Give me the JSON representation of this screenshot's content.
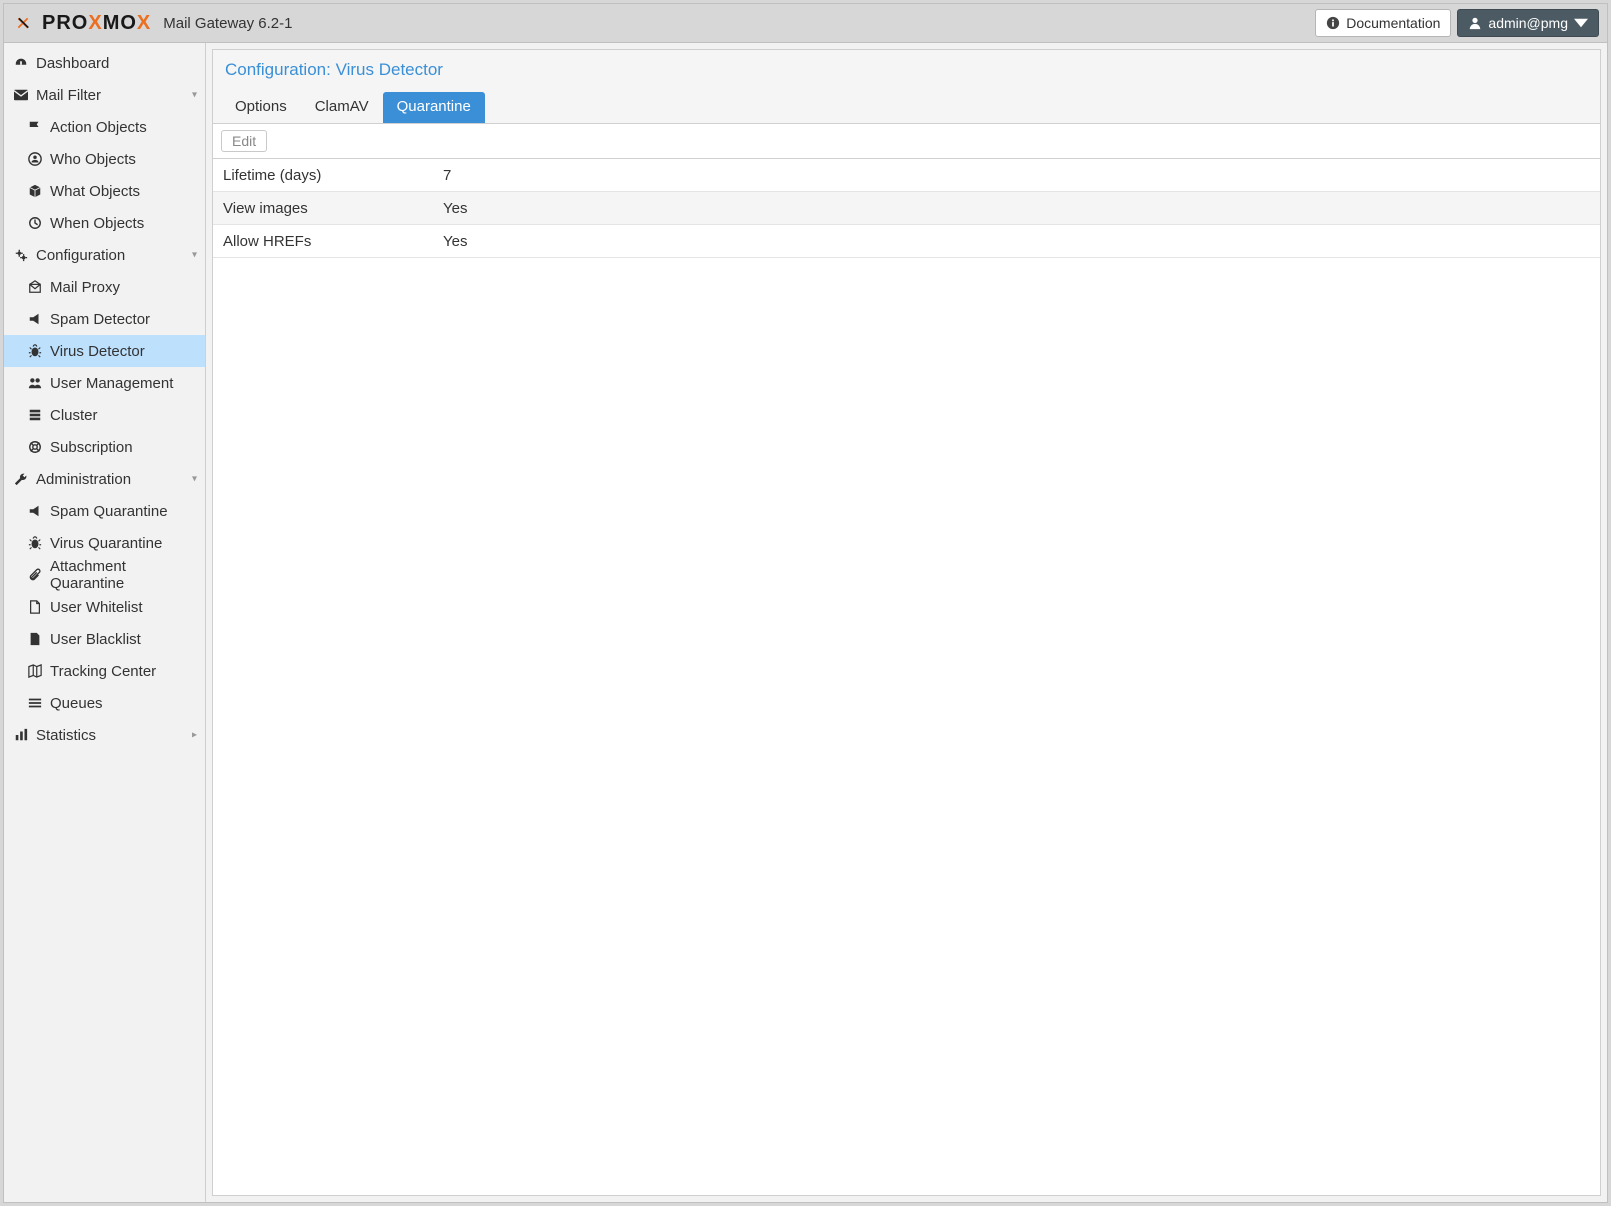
{
  "header": {
    "product": "PROXMOX",
    "title": "Mail Gateway 6.2-1",
    "doc_label": "Documentation",
    "user_label": "admin@pmg"
  },
  "sidebar": {
    "dashboard": "Dashboard",
    "mailfilter": {
      "label": "Mail Filter",
      "action_objects": "Action Objects",
      "who_objects": "Who Objects",
      "what_objects": "What Objects",
      "when_objects": "When Objects"
    },
    "configuration": {
      "label": "Configuration",
      "mail_proxy": "Mail Proxy",
      "spam_detector": "Spam Detector",
      "virus_detector": "Virus Detector",
      "user_management": "User Management",
      "cluster": "Cluster",
      "subscription": "Subscription"
    },
    "administration": {
      "label": "Administration",
      "spam_q": "Spam Quarantine",
      "virus_q": "Virus Quarantine",
      "attach_q": "Attachment Quarantine",
      "user_whitelist": "User Whitelist",
      "user_blacklist": "User Blacklist",
      "tracking_center": "Tracking Center",
      "queues": "Queues"
    },
    "statistics": "Statistics"
  },
  "main": {
    "title": "Configuration: Virus Detector",
    "tabs": {
      "options": "Options",
      "clamav": "ClamAV",
      "quarantine": "Quarantine"
    },
    "edit_label": "Edit",
    "rows": [
      {
        "name": "Lifetime (days)",
        "value": "7"
      },
      {
        "name": "View images",
        "value": "Yes"
      },
      {
        "name": "Allow HREFs",
        "value": "Yes"
      }
    ]
  }
}
